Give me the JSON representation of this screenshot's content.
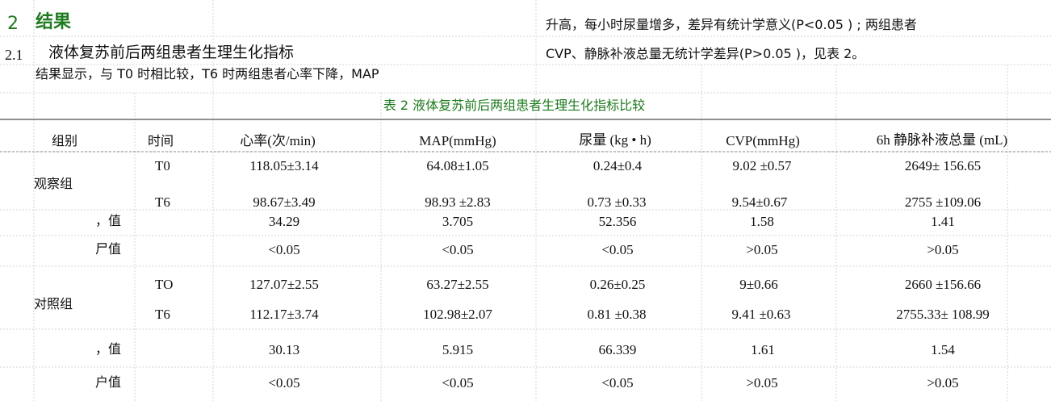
{
  "heading": {
    "number": "2",
    "title": "结果",
    "sub_number": "2.1",
    "sub_title": "液体复苏前后两组患者生理生化指标"
  },
  "text": {
    "left_line1": "结果显示，与 T0 时相比较，T6 时两组患者心率下降，MAP",
    "right_line1": "升高，每小时尿量增多，差异有统计学意义(P<0.05 ) ; 两组患者",
    "right_line2": "CVP、静脉补液总量无统计学差异(P>0.05 )，见表 2。"
  },
  "table": {
    "caption": "表 2 液体复苏前后两组患者生理生化指标比较",
    "headers": [
      "组别",
      "时间",
      "心率(次/min)",
      "MAP(mmHg)",
      "尿量 (kg • h)",
      "CVP(mmHg)",
      "6h 静脉补液总量 (mL)"
    ],
    "groups": [
      {
        "name": "观察组",
        "rows": [
          {
            "time": "T0",
            "values": [
              "118.05±3.14",
              "64.08±1.05",
              "0.24±0.4",
              "9.02 ±0.57",
              "2649± 156.65"
            ]
          },
          {
            "time": "T6",
            "values": [
              "98.67±3.49",
              "98.93 ±2.83",
              "0.73 ±0.33",
              "9.54±0.67",
              "2755 ±109.06"
            ]
          }
        ],
        "stat_rows": [
          {
            "label": "，值",
            "values": [
              "34.29",
              "3.705",
              "52.356",
              "1.58",
              "1.41"
            ]
          },
          {
            "label": "尸值",
            "values": [
              "<0.05",
              "<0.05",
              "<0.05",
              ">0.05",
              ">0.05"
            ]
          }
        ]
      },
      {
        "name": "对照组",
        "rows": [
          {
            "time": "TO",
            "values": [
              "127.07±2.55",
              "63.27±2.55",
              "0.26±0.25",
              "9±0.66",
              "2660 ±156.66"
            ]
          },
          {
            "time": "T6",
            "values": [
              "112.17±3.74",
              "102.98±2.07",
              "0.81 ±0.38",
              "9.41 ±0.63",
              "2755.33± 108.99"
            ]
          }
        ],
        "stat_rows": [
          {
            "label": "，值",
            "values": [
              "30.13",
              "5.915",
              "66.339",
              "1.61",
              "1.54"
            ]
          },
          {
            "label": "户值",
            "values": [
              "<0.05",
              "<0.05",
              "<0.05",
              ">0.05",
              ">0.05"
            ]
          }
        ]
      }
    ]
  }
}
